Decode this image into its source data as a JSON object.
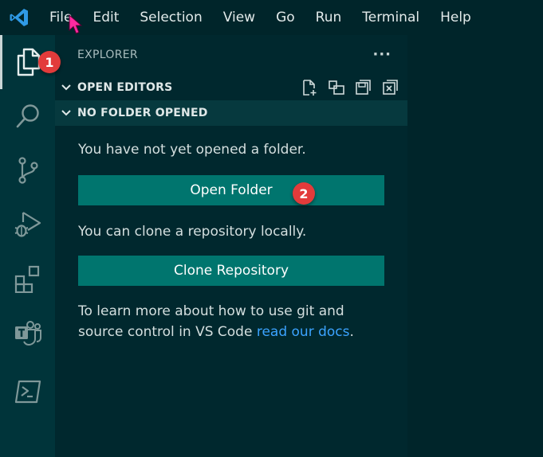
{
  "menubar": {
    "items": [
      "File",
      "Edit",
      "Selection",
      "View",
      "Go",
      "Run",
      "Terminal",
      "Help"
    ]
  },
  "activitybar": {
    "items": [
      {
        "name": "explorer",
        "icon": "files-icon"
      },
      {
        "name": "search",
        "icon": "search-icon"
      },
      {
        "name": "source-control",
        "icon": "source-control-icon"
      },
      {
        "name": "run-debug",
        "icon": "run-debug-icon"
      },
      {
        "name": "extensions",
        "icon": "extensions-icon"
      },
      {
        "name": "teams",
        "icon": "teams-icon"
      },
      {
        "name": "powershell",
        "icon": "powershell-icon"
      }
    ]
  },
  "sidebar": {
    "title": "EXPLORER",
    "more": "···",
    "open_editors": "OPEN EDITORS",
    "no_folder": "NO FOLDER OPENED",
    "message_open": "You have not yet opened a folder.",
    "open_folder_button": "Open Folder",
    "message_clone": "You can clone a repository locally.",
    "clone_button": "Clone Repository",
    "learn_line1": "To learn more about how to use git and",
    "learn_line2_prefix": "source control in VS Code ",
    "learn_link": "read our docs",
    "learn_suffix": "."
  },
  "callouts": {
    "one": "1",
    "two": "2"
  },
  "colors": {
    "background": "#00252a",
    "activitybar": "#00343a",
    "sidebar": "#00282e",
    "button": "#00756e",
    "link": "#3ba3ff",
    "badge": "#e23b3b"
  }
}
